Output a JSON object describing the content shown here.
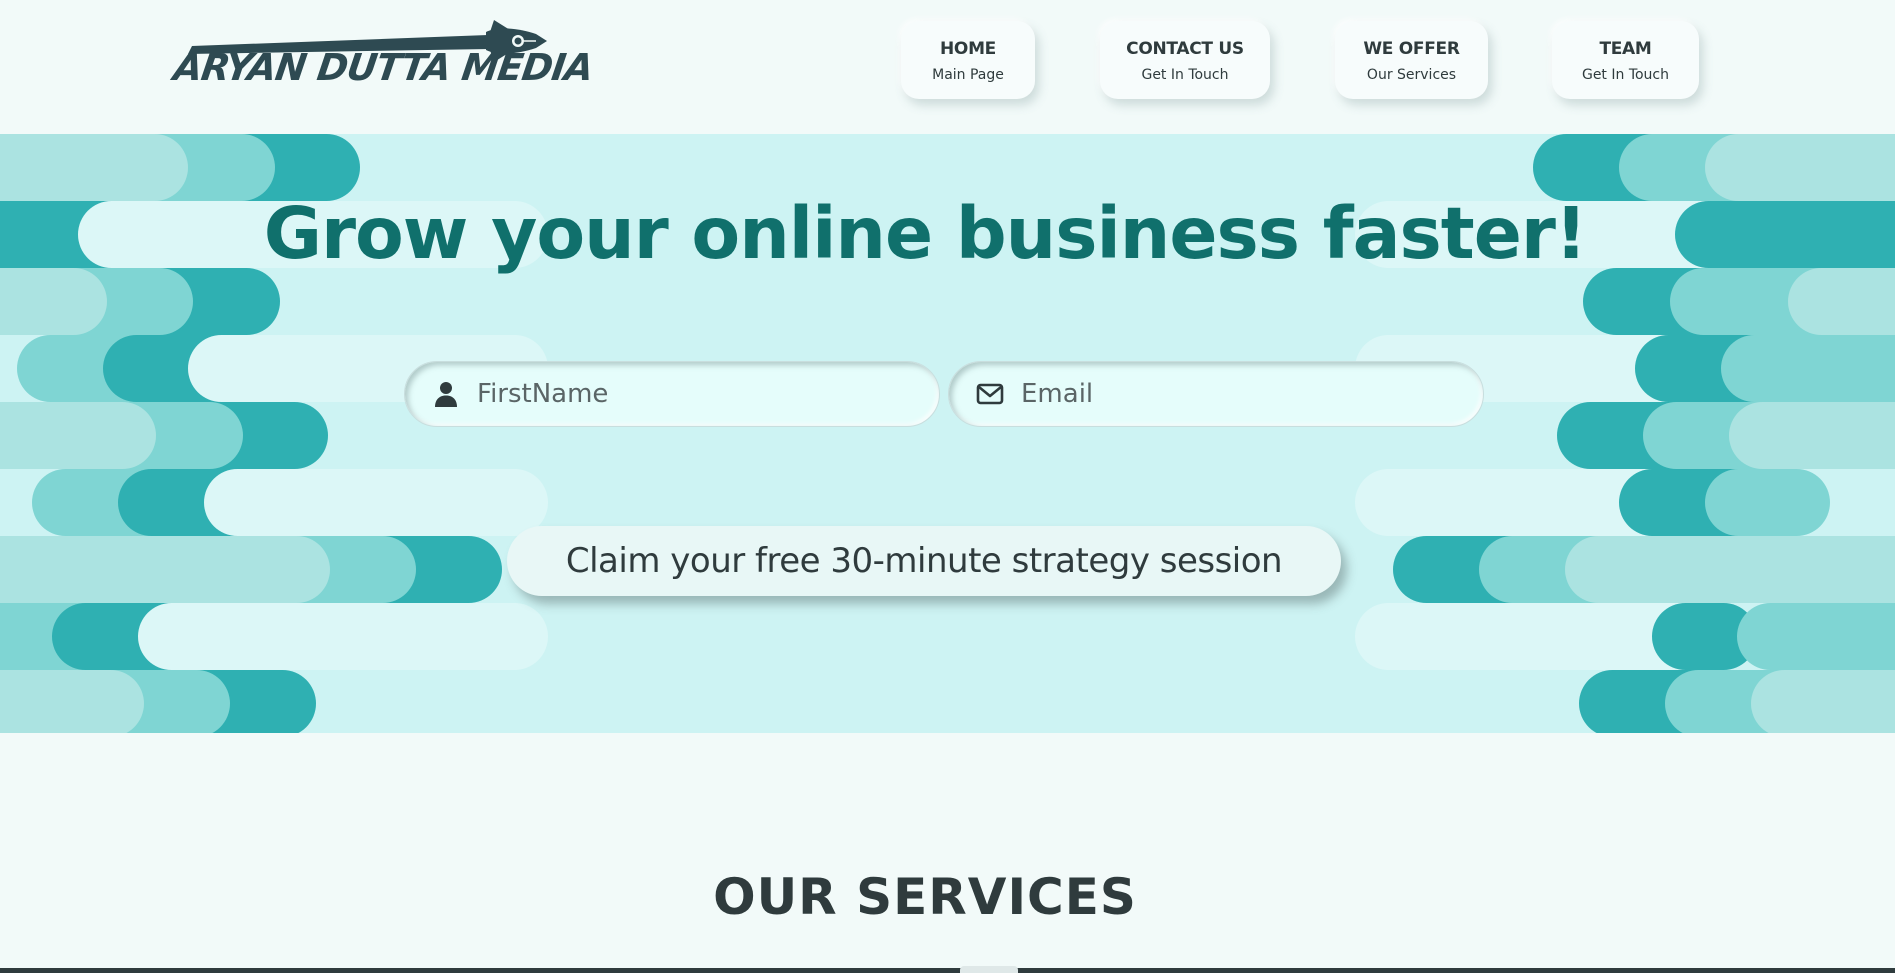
{
  "brand": {
    "name": "ARYAN DUTTA MEDIA"
  },
  "nav": [
    {
      "title": "HOME",
      "subtitle": "Main Page"
    },
    {
      "title": "CONTACT US",
      "subtitle": "Get In Touch"
    },
    {
      "title": "WE OFFER",
      "subtitle": "Our Services"
    },
    {
      "title": "TEAM",
      "subtitle": "Get In Touch"
    }
  ],
  "hero": {
    "headline": "Grow your online business faster!",
    "firstname_placeholder": "FirstName",
    "email_placeholder": "Email",
    "cta_label": "Claim your free 30-minute strategy session",
    "firstname_icon": "user-icon",
    "email_icon": "envelope-icon"
  },
  "services": {
    "title": "OUR SERVICES"
  },
  "colors": {
    "accent_dark": "#10706c",
    "teal": "#2fb0b2",
    "hero_bg": "#cdf3f3",
    "page_bg": "#f2faf9",
    "text": "#2f3b3d"
  }
}
